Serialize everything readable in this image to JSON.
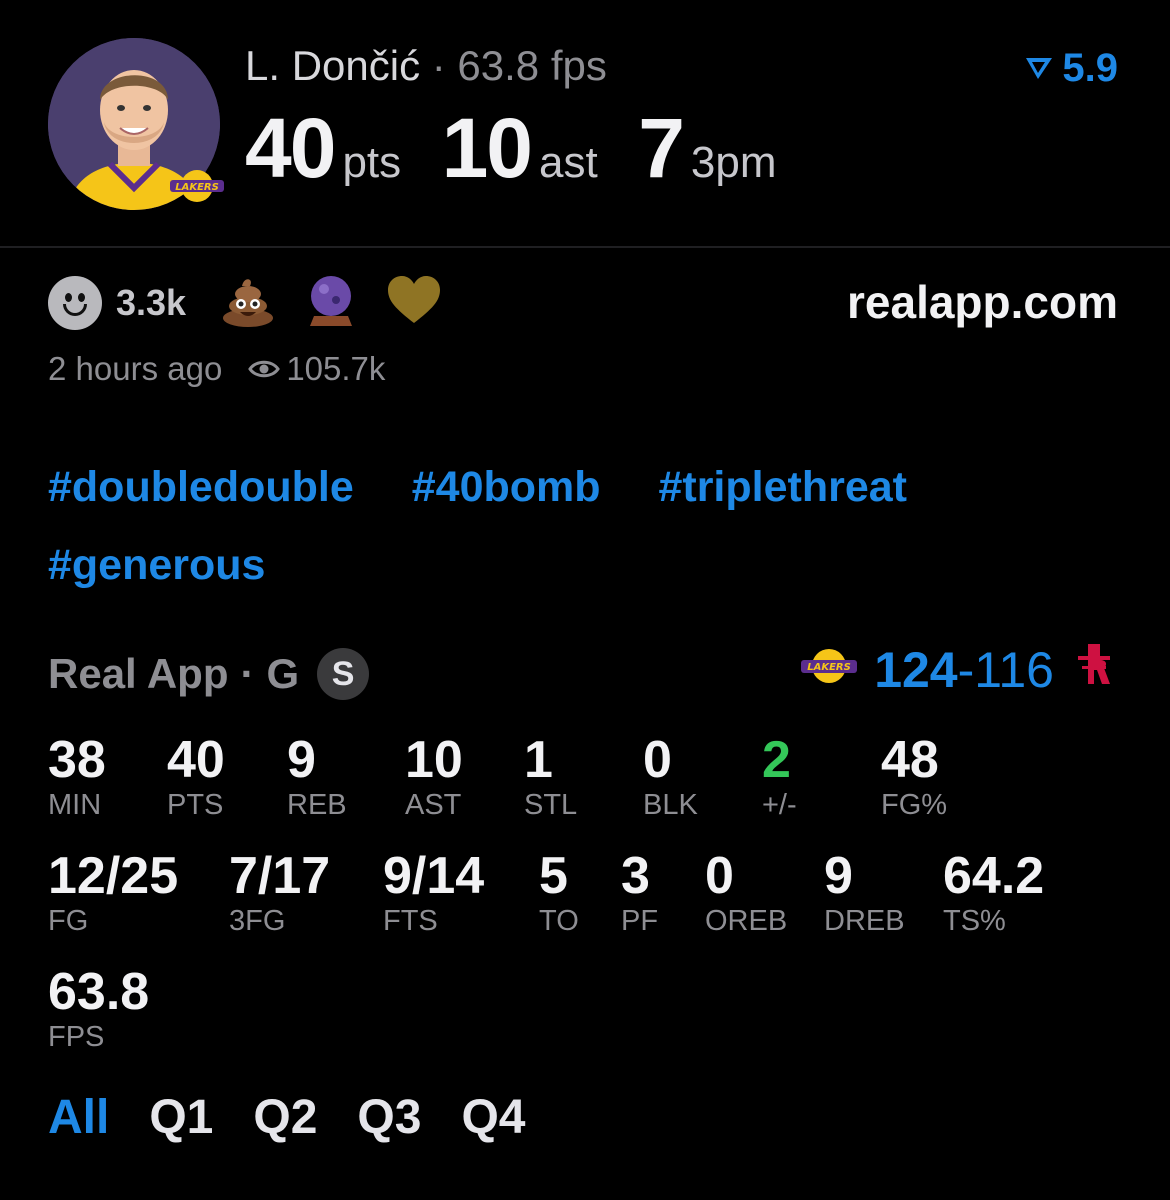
{
  "header": {
    "player_name": "L. Dončić",
    "separator": "·",
    "fps_text": "63.8 fps",
    "rating_value": "5.9",
    "headline": [
      {
        "value": "40",
        "unit": "pts"
      },
      {
        "value": "10",
        "unit": "ast"
      },
      {
        "value": "7",
        "unit": "3pm"
      }
    ]
  },
  "reactions": {
    "count": "3.3k",
    "emojis": [
      "poop-emoji",
      "crystal-ball-emoji",
      "gold-heart-emoji"
    ]
  },
  "site": "realapp.com",
  "meta": {
    "time_ago": "2 hours ago",
    "views": "105.7k"
  },
  "tags": [
    "#doubledouble",
    "#40bomb",
    "#triplethreat",
    "#generous"
  ],
  "game": {
    "source": "Real App",
    "separator": "·",
    "position": "G",
    "badge": "S",
    "home_score": "124",
    "dash": "-",
    "away_score": "116"
  },
  "stats_row1": [
    {
      "value": "38",
      "label": "MIN"
    },
    {
      "value": "40",
      "label": "PTS"
    },
    {
      "value": "9",
      "label": "REB"
    },
    {
      "value": "10",
      "label": "AST"
    },
    {
      "value": "1",
      "label": "STL"
    },
    {
      "value": "0",
      "label": "BLK"
    },
    {
      "value": "2",
      "label": "+/-"
    },
    {
      "value": "48",
      "label": "FG%"
    }
  ],
  "stats_row2": [
    {
      "value": "12/25",
      "label": "FG"
    },
    {
      "value": "7/17",
      "label": "3FG"
    },
    {
      "value": "9/14",
      "label": "FTS"
    },
    {
      "value": "5",
      "label": "TO"
    },
    {
      "value": "3",
      "label": "PF"
    },
    {
      "value": "0",
      "label": "OREB"
    },
    {
      "value": "9",
      "label": "DREB"
    },
    {
      "value": "64.2",
      "label": "TS%"
    }
  ],
  "stats_row3": [
    {
      "value": "63.8",
      "label": "FPS"
    }
  ],
  "tabs": [
    "All",
    "Q1",
    "Q2",
    "Q3",
    "Q4"
  ],
  "colors": {
    "accent": "#1e88e5",
    "positive": "#34c759",
    "background": "#000000",
    "muted": "#8e8e93"
  }
}
